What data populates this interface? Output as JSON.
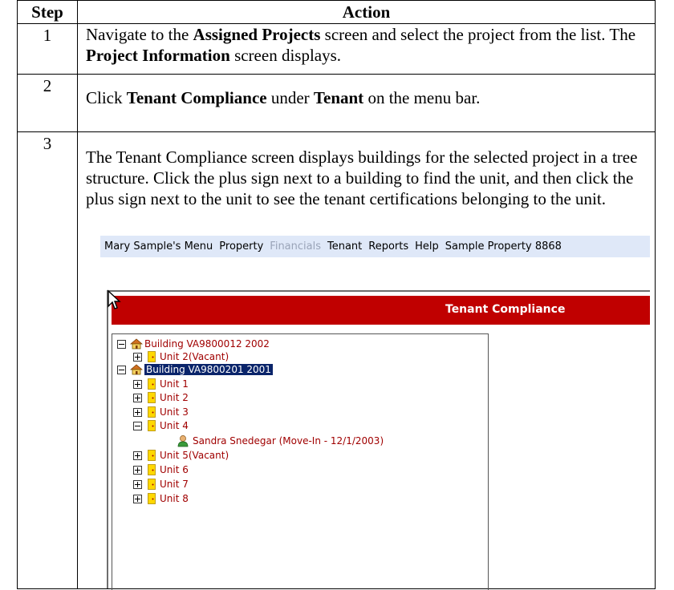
{
  "table": {
    "header_step": "Step",
    "header_action": "Action",
    "rows": [
      {
        "step": "1",
        "parts": [
          {
            "t": "Navigate to the "
          },
          {
            "t": "Assigned Projects",
            "b": true
          },
          {
            "t": " screen and select the project from the list. The "
          },
          {
            "t": "Project Information",
            "b": true
          },
          {
            "t": " screen displays."
          }
        ]
      },
      {
        "step": "2",
        "parts": [
          {
            "t": "Click "
          },
          {
            "t": "Tenant Compliance",
            "b": true
          },
          {
            "t": " under "
          },
          {
            "t": "Tenant",
            "b": true
          },
          {
            "t": " on the menu bar."
          }
        ]
      },
      {
        "step": "3",
        "text": "The Tenant Compliance screen displays buildings for the selected project in a tree structure. Click the plus sign next to a building to find the unit, and then click the plus sign next to the unit to see the tenant certifications belonging to the unit."
      }
    ]
  },
  "screenshot": {
    "menu": {
      "items": [
        "Mary Sample's Menu",
        "Property",
        "Financials",
        "Tenant",
        "Reports",
        "Help",
        "Sample Property 8868"
      ],
      "dimmed": [
        "Financials"
      ]
    },
    "title": "Tenant Compliance",
    "tree": [
      {
        "kind": "building",
        "toggle": "minus",
        "label": "Building VA9800012 2002",
        "selected": false,
        "indent": 0
      },
      {
        "kind": "unit",
        "toggle": "plus",
        "label": "Unit 2(Vacant)",
        "indent": 1
      },
      {
        "kind": "building",
        "toggle": "minus",
        "label": "Building VA9800201 2001",
        "selected": true,
        "indent": 0
      },
      {
        "kind": "unit",
        "toggle": "plus",
        "label": "Unit 1",
        "indent": 1
      },
      {
        "kind": "unit",
        "toggle": "plus",
        "label": "Unit 2",
        "indent": 1
      },
      {
        "kind": "unit",
        "toggle": "plus",
        "label": "Unit 3",
        "indent": 1
      },
      {
        "kind": "unit",
        "toggle": "minus",
        "label": "Unit 4",
        "indent": 1
      },
      {
        "kind": "tenant",
        "label": "Sandra Snedegar (Move-In - 12/1/2003)",
        "indent": 2
      },
      {
        "kind": "unit",
        "toggle": "plus",
        "label": "Unit 5(Vacant)",
        "indent": 1
      },
      {
        "kind": "unit",
        "toggle": "plus",
        "label": "Unit 6",
        "indent": 1
      },
      {
        "kind": "unit",
        "toggle": "plus",
        "label": "Unit 7",
        "indent": 1
      },
      {
        "kind": "unit",
        "toggle": "plus",
        "label": "Unit 8",
        "indent": 1
      }
    ],
    "colors": {
      "titlebar": "#c00000",
      "node_text": "#a00000",
      "selection": "#0a246a",
      "menubar": "#dfe8f8"
    }
  }
}
